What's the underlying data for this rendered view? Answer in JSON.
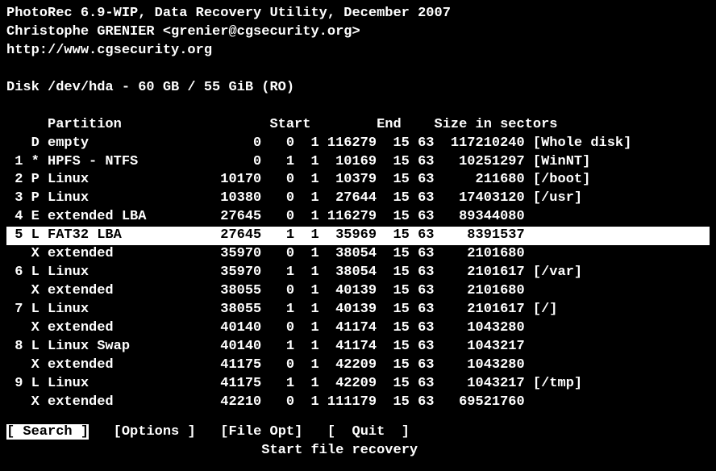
{
  "header": {
    "title_line": "PhotoRec 6.9-WIP, Data Recovery Utility, December 2007",
    "author_line": "Christophe GRENIER <grenier@cgsecurity.org>",
    "url_line": "http://www.cgsecurity.org"
  },
  "disk_line": "Disk /dev/hda - 60 GB / 55 GiB (RO)",
  "columns_header": "     Partition                  Start        End    Size in sectors",
  "rows": [
    {
      "idx": "",
      "flag": "D",
      "name": "empty",
      "c0": "0",
      "c1": "0",
      "c2": "1",
      "c3": "116279",
      "c4": "15",
      "c5": "63",
      "size": "117210240",
      "mount": "[Whole disk]",
      "selected": false
    },
    {
      "idx": "1",
      "flag": "*",
      "name": "HPFS - NTFS",
      "c0": "0",
      "c1": "1",
      "c2": "1",
      "c3": "10169",
      "c4": "15",
      "c5": "63",
      "size": "10251297",
      "mount": "[WinNT]",
      "selected": false
    },
    {
      "idx": "2",
      "flag": "P",
      "name": "Linux",
      "c0": "10170",
      "c1": "0",
      "c2": "1",
      "c3": "10379",
      "c4": "15",
      "c5": "63",
      "size": "211680",
      "mount": "[/boot]",
      "selected": false
    },
    {
      "idx": "3",
      "flag": "P",
      "name": "Linux",
      "c0": "10380",
      "c1": "0",
      "c2": "1",
      "c3": "27644",
      "c4": "15",
      "c5": "63",
      "size": "17403120",
      "mount": "[/usr]",
      "selected": false
    },
    {
      "idx": "4",
      "flag": "E",
      "name": "extended LBA",
      "c0": "27645",
      "c1": "0",
      "c2": "1",
      "c3": "116279",
      "c4": "15",
      "c5": "63",
      "size": "89344080",
      "mount": "",
      "selected": false
    },
    {
      "idx": "5",
      "flag": "L",
      "name": "FAT32 LBA",
      "c0": "27645",
      "c1": "1",
      "c2": "1",
      "c3": "35969",
      "c4": "15",
      "c5": "63",
      "size": "8391537",
      "mount": "",
      "selected": true
    },
    {
      "idx": "",
      "flag": "X",
      "name": "extended",
      "c0": "35970",
      "c1": "0",
      "c2": "1",
      "c3": "38054",
      "c4": "15",
      "c5": "63",
      "size": "2101680",
      "mount": "",
      "selected": false
    },
    {
      "idx": "6",
      "flag": "L",
      "name": "Linux",
      "c0": "35970",
      "c1": "1",
      "c2": "1",
      "c3": "38054",
      "c4": "15",
      "c5": "63",
      "size": "2101617",
      "mount": "[/var]",
      "selected": false
    },
    {
      "idx": "",
      "flag": "X",
      "name": "extended",
      "c0": "38055",
      "c1": "0",
      "c2": "1",
      "c3": "40139",
      "c4": "15",
      "c5": "63",
      "size": "2101680",
      "mount": "",
      "selected": false
    },
    {
      "idx": "7",
      "flag": "L",
      "name": "Linux",
      "c0": "38055",
      "c1": "1",
      "c2": "1",
      "c3": "40139",
      "c4": "15",
      "c5": "63",
      "size": "2101617",
      "mount": "[/]",
      "selected": false
    },
    {
      "idx": "",
      "flag": "X",
      "name": "extended",
      "c0": "40140",
      "c1": "0",
      "c2": "1",
      "c3": "41174",
      "c4": "15",
      "c5": "63",
      "size": "1043280",
      "mount": "",
      "selected": false
    },
    {
      "idx": "8",
      "flag": "L",
      "name": "Linux Swap",
      "c0": "40140",
      "c1": "1",
      "c2": "1",
      "c3": "41174",
      "c4": "15",
      "c5": "63",
      "size": "1043217",
      "mount": "",
      "selected": false
    },
    {
      "idx": "",
      "flag": "X",
      "name": "extended",
      "c0": "41175",
      "c1": "0",
      "c2": "1",
      "c3": "42209",
      "c4": "15",
      "c5": "63",
      "size": "1043280",
      "mount": "",
      "selected": false
    },
    {
      "idx": "9",
      "flag": "L",
      "name": "Linux",
      "c0": "41175",
      "c1": "1",
      "c2": "1",
      "c3": "42209",
      "c4": "15",
      "c5": "63",
      "size": "1043217",
      "mount": "[/tmp]",
      "selected": false
    },
    {
      "idx": "",
      "flag": "X",
      "name": "extended",
      "c0": "42210",
      "c1": "0",
      "c2": "1",
      "c3": "111179",
      "c4": "15",
      "c5": "63",
      "size": "69521760",
      "mount": "",
      "selected": false
    }
  ],
  "footer": {
    "search": "[ Search ]",
    "options": "[Options ]",
    "fileopt": "[File Opt]",
    "quit": "[  Quit  ]",
    "help": "Start file recovery"
  }
}
